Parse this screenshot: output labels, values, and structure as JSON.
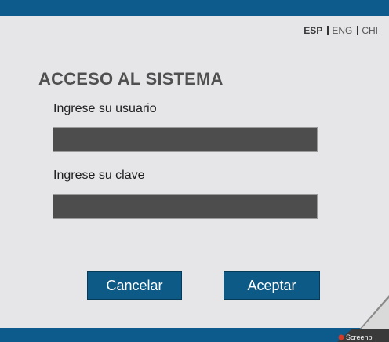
{
  "languages": {
    "esp": "ESP",
    "eng": "ENG",
    "chi": "CHI"
  },
  "login": {
    "title": "ACCESO AL SISTEMA",
    "user_label": "Ingrese su usuario",
    "user_value": "",
    "pass_label": "Ingrese su clave",
    "pass_value": ""
  },
  "buttons": {
    "cancel": "Cancelar",
    "accept": "Aceptar"
  },
  "overlay": {
    "text": "Screenp"
  },
  "colors": {
    "brand_blue": "#0d5b8c",
    "background": "#e6e5e8",
    "field_bg": "#4d4d4d"
  }
}
